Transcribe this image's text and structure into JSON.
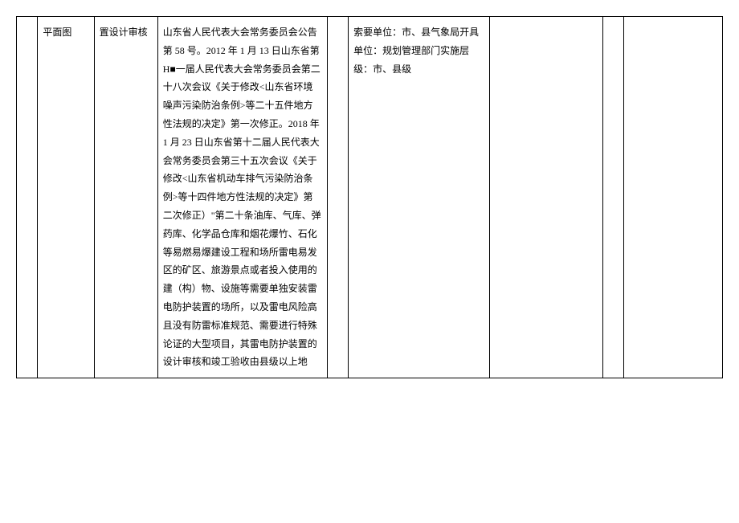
{
  "table": {
    "row": {
      "col1": "",
      "col2": "平面图",
      "col3": "置设计审核",
      "col4": "山东省人民代表大会常务委员会公告第 58 号。2012 年 1 月 13 日山东省第 H■一届人民代表大会常务委员会第二十八次会议《关于修改<山东省环境噪声污染防治条例>等二十五件地方性法规的决定》第一次修正。2018 年 1 月 23 日山东省第十二届人民代表大会常务委员会第三十五次会议《关于修改<山东省机动车排气污染防治条例>等十四件地方性法规的决定》第二次修正）\"第二十条油库、气库、弹药库、化学品仓库和烟花爆竹、石化等易燃易爆建设工程和场所雷电易发区的矿区、旅游景点或者投入使用的建（构）物、设施等需要单独安装雷电防护装置的场所，以及雷电风险高且没有防雷标准规范、需要进行特殊论证的大型项目，其雷电防护装置的设计审核和竣工验收由县级以上地",
      "col5": "",
      "col6": "索要单位：市、县气象局开具单位：规划管理部门实施层级：市、县级",
      "col7": "",
      "col8": "",
      "col9": ""
    }
  }
}
